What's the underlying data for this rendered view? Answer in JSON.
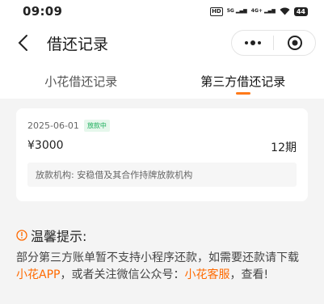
{
  "status_bar": {
    "time": "09:09",
    "hd_label": "HD",
    "net1": "5G",
    "net2": "4G+",
    "battery": "44"
  },
  "nav": {
    "title": "借还记录"
  },
  "tabs": [
    {
      "label": "小花借还记录",
      "active": false
    },
    {
      "label": "第三方借还记录",
      "active": true
    }
  ],
  "record": {
    "date": "2025-06-01",
    "status": "放款中",
    "amount": "¥3000",
    "term": "12期",
    "institution_label": "放款机构:",
    "institution": "安稳借及其合作持牌放款机构"
  },
  "tip": {
    "icon": "warning-circle-icon",
    "title": "温馨提示:",
    "text_1": "部分第三方账单暂不支持小程序还款，如需要还款请下载",
    "link_1": "小花APP",
    "text_2": "，或者关注微信公众号：",
    "link_2": "小花客服",
    "text_3": "，查看!"
  },
  "colors": {
    "accent": "#ff6a00",
    "status_green": "#1aad5a",
    "page_bg": "#f4f4f4"
  }
}
